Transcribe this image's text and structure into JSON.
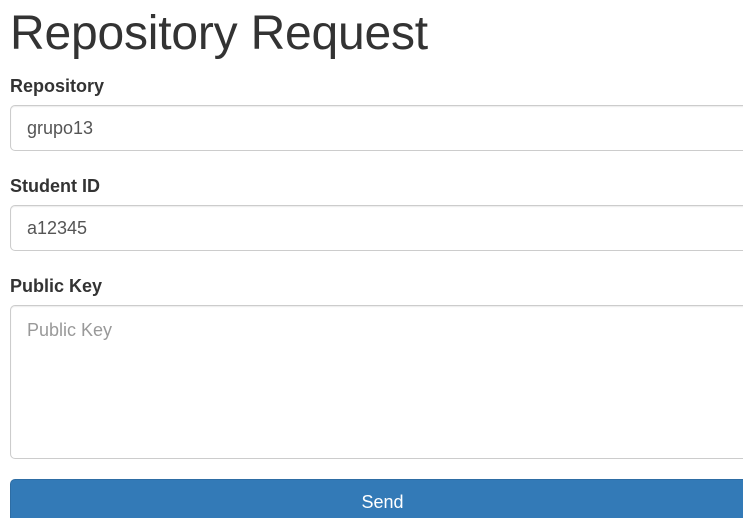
{
  "page": {
    "title": "Repository Request"
  },
  "form": {
    "repository": {
      "label": "Repository",
      "value": "grupo13"
    },
    "student_id": {
      "label": "Student ID",
      "value": "a12345"
    },
    "public_key": {
      "label": "Public Key",
      "value": "",
      "placeholder": "Public Key"
    },
    "send_label": "Send"
  },
  "colors": {
    "primary_button": "#337ab7",
    "border": "#cccccc",
    "text": "#333333"
  }
}
